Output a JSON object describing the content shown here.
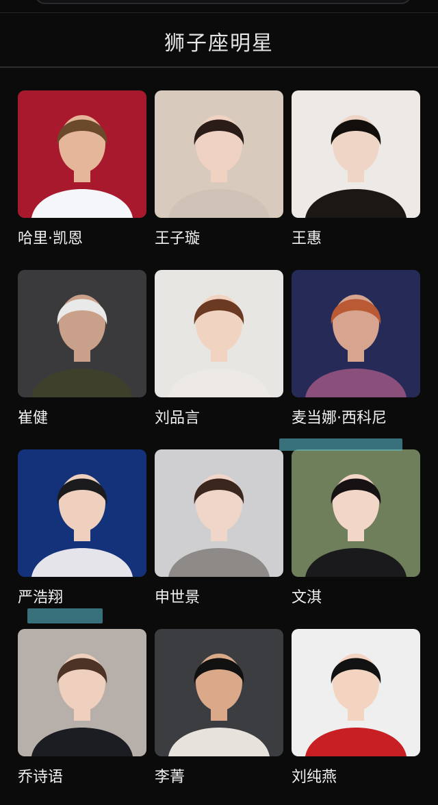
{
  "section": {
    "title": "狮子座明星"
  },
  "celebrities": [
    {
      "name": "哈里·凯恩",
      "bg": "#a8192d",
      "shirt": "#f4f6f9",
      "hair": "#6b4a2b",
      "skin": "#e5b69a",
      "icon": "footballer-photo"
    },
    {
      "name": "王子璇",
      "bg": "#d8cbbd",
      "shirt": "#cfc3b8",
      "hair": "#2a1d18",
      "skin": "#efd2c2",
      "icon": "actress-photo"
    },
    {
      "name": "王惠",
      "bg": "#ece9e6",
      "shirt": "#1a1715",
      "hair": "#120e0c",
      "skin": "#efd5c6",
      "icon": "model-photo"
    },
    {
      "name": "崔健",
      "bg": "#3a3a3c",
      "shirt": "#3e402c",
      "hair": "#e9e9e9",
      "skin": "#c9a18a",
      "icon": "musician-photo"
    },
    {
      "name": "刘品言",
      "bg": "#e8e6e3",
      "shirt": "#edeae5",
      "hair": "#6a3a22",
      "skin": "#f0d4c1",
      "icon": "actress-photo"
    },
    {
      "name": "麦当娜·西科尼",
      "bg": "#262a56",
      "shirt": "#8a4f7a",
      "hair": "#b95a35",
      "skin": "#d7a48f",
      "icon": "singer-photo"
    },
    {
      "name": "严浩翔",
      "bg": "#13327a",
      "shirt": "#e4e4ea",
      "hair": "#1b1b1e",
      "skin": "#efcfbe",
      "icon": "idol-photo"
    },
    {
      "name": "申世景",
      "bg": "#cfcfd1",
      "shirt": "#8d8a88",
      "hair": "#3a261d",
      "skin": "#f0d6c8",
      "icon": "actress-photo"
    },
    {
      "name": "文淇",
      "bg": "#6f7f5c",
      "shirt": "#1a1a1c",
      "hair": "#161214",
      "skin": "#f2d6c8",
      "icon": "actress-photo"
    },
    {
      "name": "乔诗语",
      "bg": "#b7b0aa",
      "shirt": "#1c1d22",
      "hair": "#4d3326",
      "skin": "#efcfbd",
      "icon": "actress-photo"
    },
    {
      "name": "李菁",
      "bg": "#3b3d40",
      "shirt": "#e7e3dc",
      "hair": "#111111",
      "skin": "#d9a98a",
      "icon": "comedian-photo"
    },
    {
      "name": "刘纯燕",
      "bg": "#efefef",
      "shirt": "#c81f24",
      "hair": "#121212",
      "skin": "#f3d4c0",
      "icon": "host-photo"
    }
  ]
}
